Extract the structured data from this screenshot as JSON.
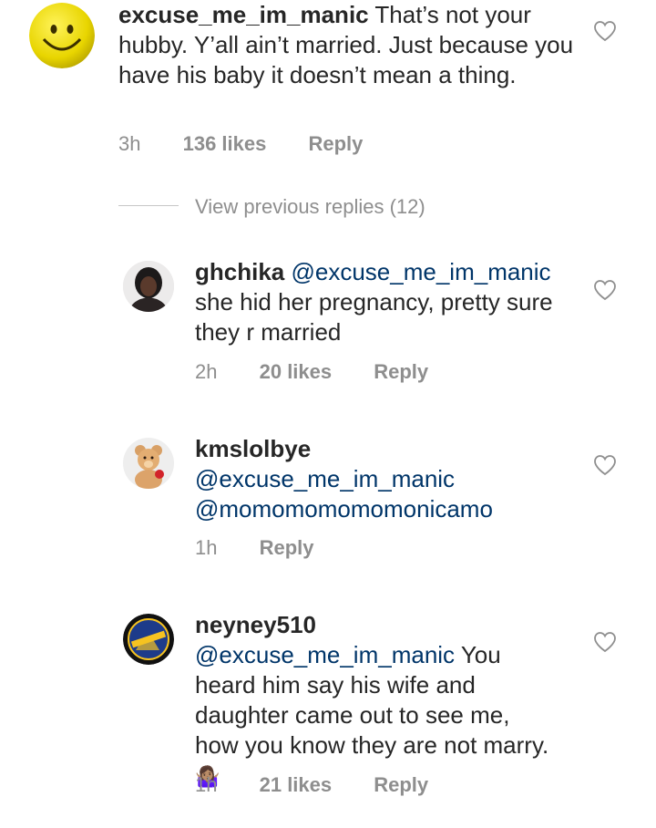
{
  "comments": [
    {
      "username": "excuse_me_im_manic",
      "mention": "",
      "text": "That’s not your hubby. Y’all ain’t married. Just because you have his baby it doesn’t mean a thing.",
      "time": "3h",
      "likes": "136 likes",
      "reply": "Reply"
    },
    {
      "username": "ghchika",
      "mention": "@excuse_me_im_manic",
      "text": "she hid her pregnancy, pretty sure they r married",
      "time": "2h",
      "likes": "20 likes",
      "reply": "Reply"
    },
    {
      "username": "kmslolbye",
      "mention": "@excuse_me_im_manic",
      "mention2": "@momomomomomonicamo",
      "text": "",
      "time": "1h",
      "likes": "",
      "reply": "Reply"
    },
    {
      "username": "neyney510",
      "mention": "@excuse_me_im_manic",
      "text": "You heard him say his wife and daughter came out to see me, how you know they are not marry.",
      "emoji": "🤷🏽‍♀️",
      "time": "1h",
      "likes": "21 likes",
      "reply": "Reply"
    }
  ],
  "view_previous": "View previous replies (12)",
  "colors": {
    "text": "#262626",
    "secondary": "#8e8e8e",
    "mention": "#003569"
  },
  "icons": {
    "like": "heart-icon",
    "smiley": "smiley-avatar",
    "warrior": "warrior-logo-avatar"
  }
}
